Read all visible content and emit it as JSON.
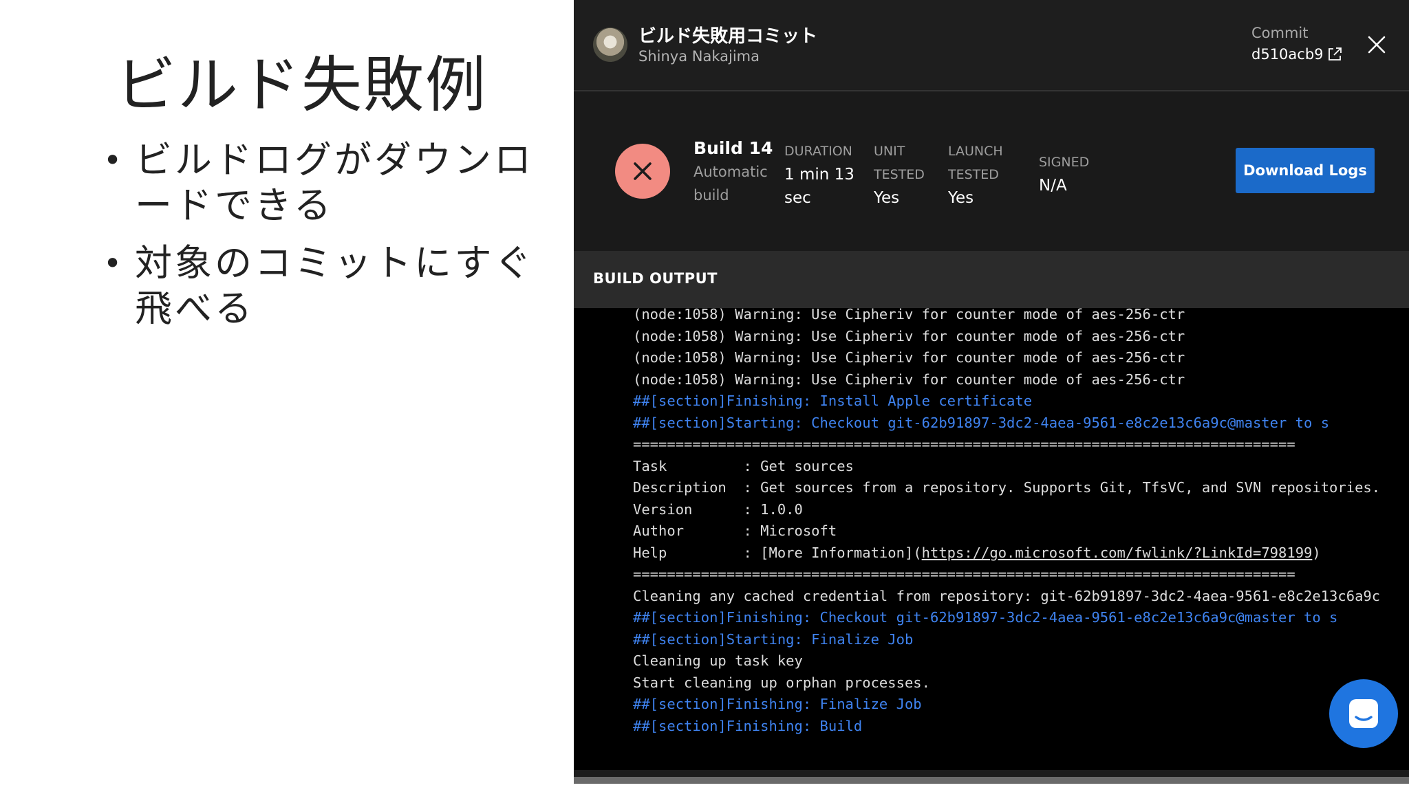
{
  "slide": {
    "title": "ビルド失敗例",
    "bullets": [
      "ビルドログがダウンロードできる",
      "対象のコミットにすぐ飛べる"
    ]
  },
  "commit": {
    "title": "ビルド失敗用コミット",
    "author": "Shinya Nakajima",
    "label": "Commit",
    "hash": "d510acb9",
    "icons": {
      "avatar": "user-avatar",
      "external": "external-link-icon",
      "close": "close-icon"
    }
  },
  "build": {
    "status": "failed",
    "status_icon": "x-icon",
    "status_color": "#f28b82",
    "title": "Build 14",
    "subtitle": "Automatic build",
    "stats": {
      "duration": {
        "label": "DURATION",
        "value": "1 min 13 sec"
      },
      "unit_tested": {
        "label": "UNIT TESTED",
        "value": "Yes"
      },
      "launch_tested": {
        "label": "LAUNCH TESTED",
        "value": "Yes"
      },
      "signed": {
        "label": "SIGNED",
        "value": "N/A"
      }
    },
    "download_label": "Download Logs",
    "accent_color": "#1b6ac9"
  },
  "output": {
    "title": "BUILD OUTPUT",
    "lines": [
      "(node:1058) Warning: Use Cipheriv for counter mode of aes-256-ctr",
      "(node:1058) Warning: Use Cipheriv for counter mode of aes-256-ctr",
      "(node:1058) Warning: Use Cipheriv for counter mode of aes-256-ctr",
      "(node:1058) Warning: Use Cipheriv for counter mode of aes-256-ctr",
      "##[section]Finishing: Install Apple certificate",
      "##[section]Starting: Checkout git-62b91897-3dc2-4aea-9561-e8c2e13c6a9c@master to s",
      "==============================================================================",
      "Task         : Get sources",
      "Description  : Get sources from a repository. Supports Git, TfsVC, and SVN repositories.",
      "Version      : 1.0.0",
      "Author       : Microsoft",
      "Help         : [More Information](",
      "==============================================================================",
      "Cleaning any cached credential from repository: git-62b91897-3dc2-4aea-9561-e8c2e13c6a9c",
      "##[section]Finishing: Checkout git-62b91897-3dc2-4aea-9561-e8c2e13c6a9c@master to s",
      "##[section]Starting: Finalize Job",
      "Cleaning up task key",
      "Start cleaning up orphan processes.",
      "##[section]Finishing: Finalize Job",
      "##[section]Finishing: Build"
    ],
    "help_link": "https://go.microsoft.com/fwlink/?LinkId=798199",
    "help_suffix": ")",
    "section_color": "#3f83f0"
  },
  "chat": {
    "icon": "chat-bubble-icon"
  }
}
